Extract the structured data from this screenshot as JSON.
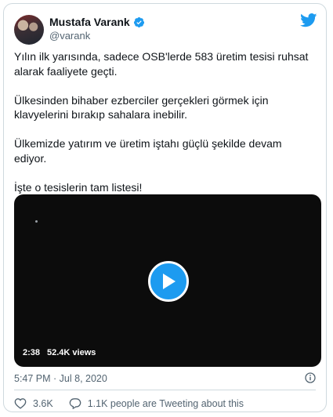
{
  "tweet": {
    "author": {
      "display_name": "Mustafa Varank",
      "handle": "@varank",
      "verified": true
    },
    "paragraphs": [
      "Yılın ilk yarısında, sadece OSB'lerde 583 üretim tesisi ruhsat\nalarak faaliyete geçti.",
      "Ülkesinden bihaber ezberciler gerçekleri görmek için\nklavyelerini bırakıp sahalara inebilir.",
      "Ülkemizde yatırım ve üretim iştahı güçlü şekilde devam\nediyor.",
      "İşte o tesislerin tam listesi!"
    ],
    "media": {
      "duration": "2:38",
      "views": "52.4K views"
    },
    "timestamp": "5:47 PM · Jul 8, 2020",
    "actions": {
      "likes": "3.6K",
      "comments": "1.1K people are Tweeting about this"
    }
  },
  "colors": {
    "accent": "#1d9bf0",
    "text": "#0f1419",
    "muted": "#536471",
    "border": "#cfd9de"
  },
  "icons": {
    "brand": "twitter-bird-icon",
    "verified": "verified-badge-icon",
    "play": "play-icon",
    "info": "info-icon",
    "like": "heart-icon",
    "comment": "speech-bubble-icon"
  }
}
